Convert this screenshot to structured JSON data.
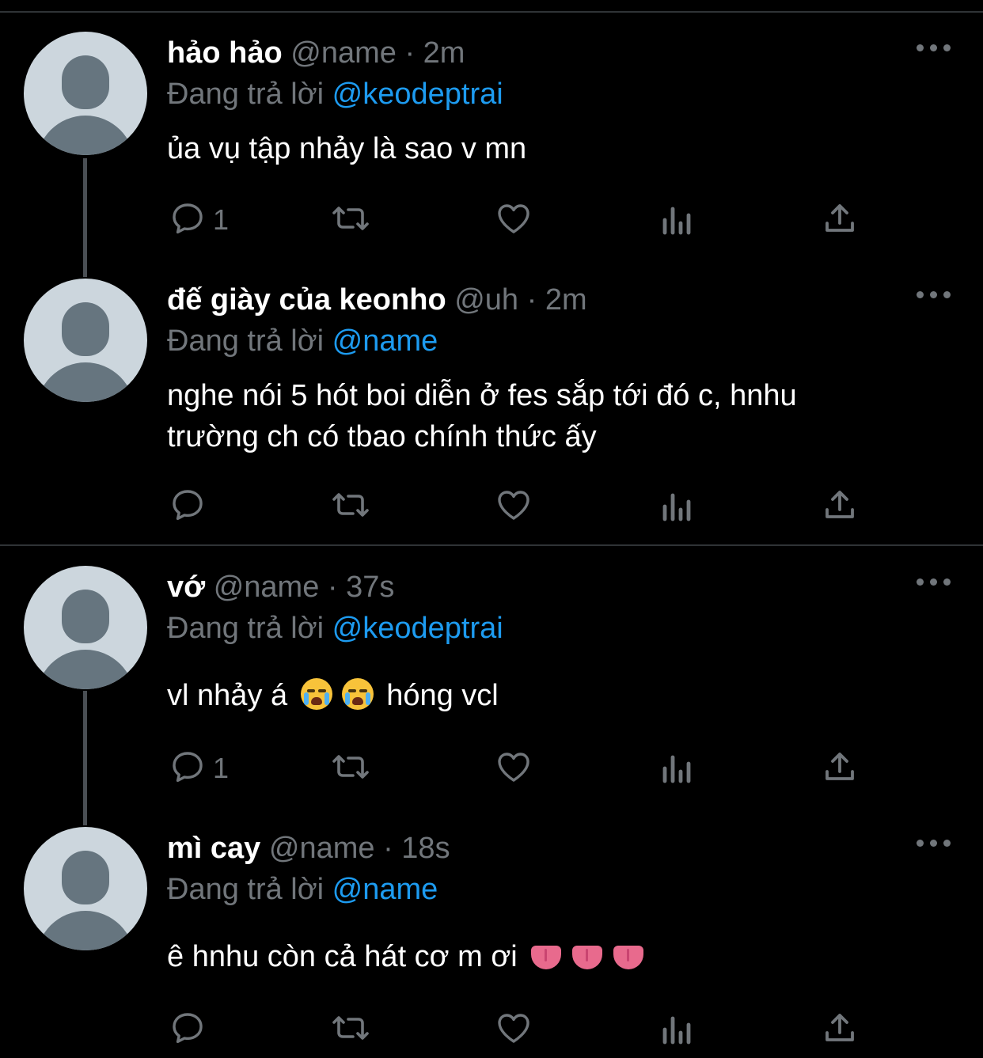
{
  "tweets": [
    {
      "name": "hảo hảo",
      "handle": "@name",
      "dot": "·",
      "time": "2m",
      "reply_prefix": "Đang trả lời",
      "reply_to": "@keodeptrai",
      "text": "ủa vụ tập nhảy là sao v mn",
      "reply_count": "1"
    },
    {
      "name": "đế giày của keonho",
      "handle": "@uh",
      "dot": "·",
      "time": "2m",
      "reply_prefix": "Đang trả lời",
      "reply_to": "@name",
      "text_line1": "nghe nói 5 hót boi diễn ở fes sắp tới đó c, hnhu",
      "text_line2": "trường ch có tbao chính thức ấy",
      "reply_count": ""
    },
    {
      "name": "vớ",
      "handle": "@name",
      "dot": "·",
      "time": "37s",
      "reply_prefix": "Đang trả lời",
      "reply_to": "@keodeptrai",
      "text_before": "vl nhảy á",
      "text_after": "hóng vcl",
      "emoji": "loudly-crying-face",
      "reply_count": "1"
    },
    {
      "name": "mì cay",
      "handle": "@name",
      "dot": "·",
      "time": "18s",
      "reply_prefix": "Đang trả lời",
      "reply_to": "@name",
      "text": "ê hnhu còn cả hát cơ m ơi",
      "emoji": "tongue",
      "reply_count": ""
    }
  ],
  "colors": {
    "background": "#000000",
    "text": "#ffffff",
    "muted": "#71767b",
    "mention": "#1d9bf0",
    "avatar_bg": "#ccd6dd",
    "avatar_fg": "#66757f"
  },
  "icons": [
    "reply-icon",
    "retweet-icon",
    "like-icon",
    "views-icon",
    "share-icon",
    "more-icon"
  ]
}
